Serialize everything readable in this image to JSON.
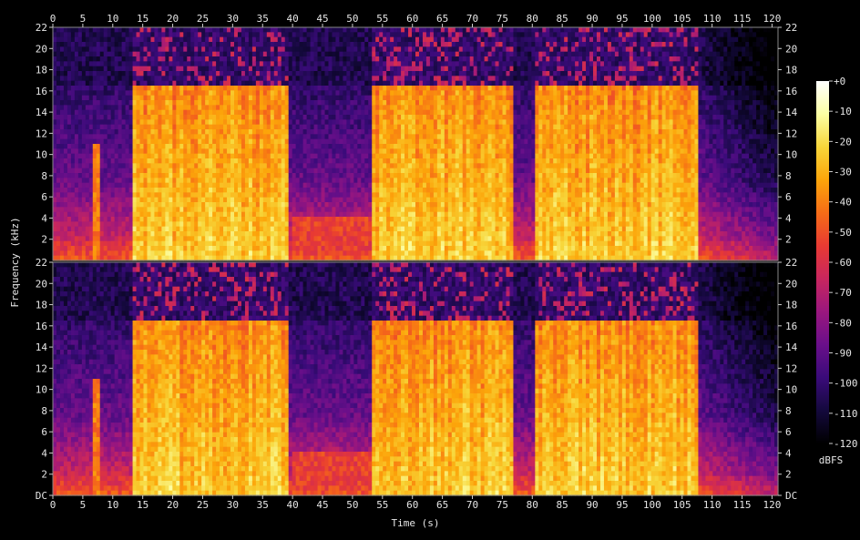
{
  "chart_data": {
    "type": "heatmap",
    "xlabel": "Time (s)",
    "ylabel": "Frequency (kHz)",
    "xlim": [
      0,
      121
    ],
    "ylim": [
      0,
      22
    ],
    "x_ticks": [
      "0",
      "5",
      "10",
      "15",
      "20",
      "25",
      "30",
      "35",
      "40",
      "45",
      "50",
      "55",
      "60",
      "65",
      "70",
      "75",
      "80",
      "85",
      "90",
      "95",
      "100",
      "105",
      "110",
      "115",
      "120"
    ],
    "y_ticks_top": [
      "2",
      "4",
      "6",
      "8",
      "10",
      "12",
      "14",
      "16",
      "18",
      "20",
      "22"
    ],
    "y_ticks_bottom": [
      "DC",
      "2",
      "4",
      "6",
      "8",
      "10",
      "12",
      "14",
      "16",
      "18",
      "20",
      "22"
    ],
    "channels": 2,
    "colorbar": {
      "label": "dBFS",
      "ticks": [
        "+0",
        "-10",
        "-20",
        "-30",
        "-40",
        "-50",
        "-60",
        "-70",
        "-80",
        "-90",
        "-100",
        "-110",
        "-120"
      ],
      "colormap": [
        "#000000",
        "#14093d",
        "#3a0b7a",
        "#6a0f8a",
        "#9a177e",
        "#c8265e",
        "#e83a33",
        "#f66c17",
        "#fca50a",
        "#f7d63a",
        "#fcffa4",
        "#ffffff"
      ]
    },
    "loud_segments_s": [
      [
        13.5,
        39.5
      ],
      [
        53,
        77
      ],
      [
        80.5,
        107.5
      ]
    ],
    "quiet_segments_s": [
      [
        0,
        13.5
      ],
      [
        39.5,
        53
      ],
      [
        77,
        80.5
      ],
      [
        107.5,
        121
      ]
    ],
    "energy_cutoff_khz": 16.5
  }
}
